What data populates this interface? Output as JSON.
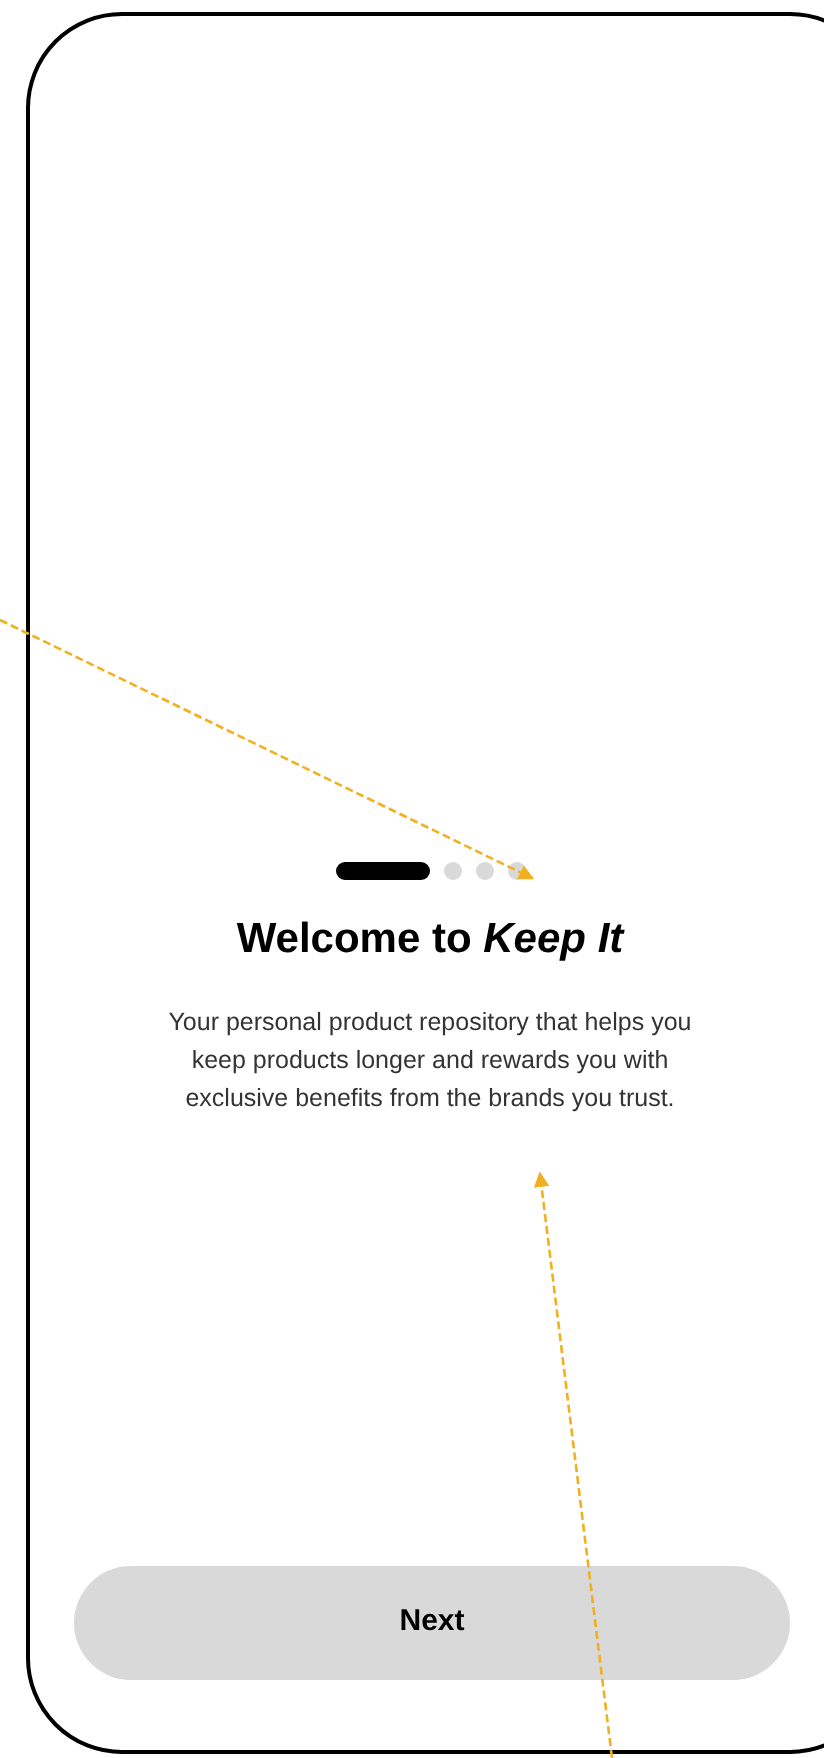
{
  "pages": [
    {
      "selected": true
    },
    {
      "selected": false
    },
    {
      "selected": false
    },
    {
      "selected": false
    }
  ],
  "title": "Welcome to *Keep It*",
  "description": "Your personal product repository that helps you keep products longer and rewards you with exclusive benefits from the brands you trust.",
  "button": "Next"
}
